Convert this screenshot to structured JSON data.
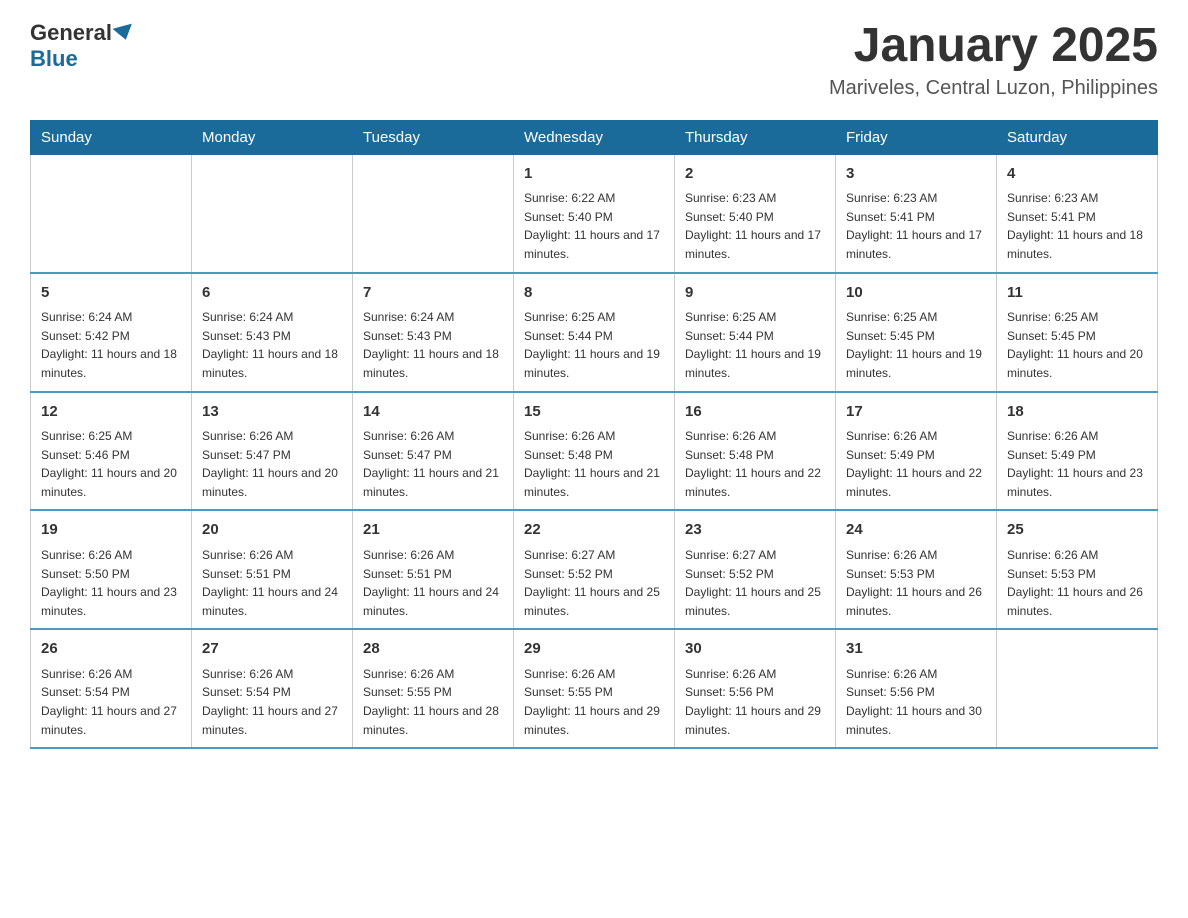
{
  "header": {
    "logo_general": "General",
    "logo_blue": "Blue",
    "month_title": "January 2025",
    "location": "Mariveles, Central Luzon, Philippines"
  },
  "days_of_week": [
    "Sunday",
    "Monday",
    "Tuesday",
    "Wednesday",
    "Thursday",
    "Friday",
    "Saturday"
  ],
  "weeks": [
    [
      {
        "day": "",
        "sunrise": "",
        "sunset": "",
        "daylight": ""
      },
      {
        "day": "",
        "sunrise": "",
        "sunset": "",
        "daylight": ""
      },
      {
        "day": "",
        "sunrise": "",
        "sunset": "",
        "daylight": ""
      },
      {
        "day": "1",
        "sunrise": "Sunrise: 6:22 AM",
        "sunset": "Sunset: 5:40 PM",
        "daylight": "Daylight: 11 hours and 17 minutes."
      },
      {
        "day": "2",
        "sunrise": "Sunrise: 6:23 AM",
        "sunset": "Sunset: 5:40 PM",
        "daylight": "Daylight: 11 hours and 17 minutes."
      },
      {
        "day": "3",
        "sunrise": "Sunrise: 6:23 AM",
        "sunset": "Sunset: 5:41 PM",
        "daylight": "Daylight: 11 hours and 17 minutes."
      },
      {
        "day": "4",
        "sunrise": "Sunrise: 6:23 AM",
        "sunset": "Sunset: 5:41 PM",
        "daylight": "Daylight: 11 hours and 18 minutes."
      }
    ],
    [
      {
        "day": "5",
        "sunrise": "Sunrise: 6:24 AM",
        "sunset": "Sunset: 5:42 PM",
        "daylight": "Daylight: 11 hours and 18 minutes."
      },
      {
        "day": "6",
        "sunrise": "Sunrise: 6:24 AM",
        "sunset": "Sunset: 5:43 PM",
        "daylight": "Daylight: 11 hours and 18 minutes."
      },
      {
        "day": "7",
        "sunrise": "Sunrise: 6:24 AM",
        "sunset": "Sunset: 5:43 PM",
        "daylight": "Daylight: 11 hours and 18 minutes."
      },
      {
        "day": "8",
        "sunrise": "Sunrise: 6:25 AM",
        "sunset": "Sunset: 5:44 PM",
        "daylight": "Daylight: 11 hours and 19 minutes."
      },
      {
        "day": "9",
        "sunrise": "Sunrise: 6:25 AM",
        "sunset": "Sunset: 5:44 PM",
        "daylight": "Daylight: 11 hours and 19 minutes."
      },
      {
        "day": "10",
        "sunrise": "Sunrise: 6:25 AM",
        "sunset": "Sunset: 5:45 PM",
        "daylight": "Daylight: 11 hours and 19 minutes."
      },
      {
        "day": "11",
        "sunrise": "Sunrise: 6:25 AM",
        "sunset": "Sunset: 5:45 PM",
        "daylight": "Daylight: 11 hours and 20 minutes."
      }
    ],
    [
      {
        "day": "12",
        "sunrise": "Sunrise: 6:25 AM",
        "sunset": "Sunset: 5:46 PM",
        "daylight": "Daylight: 11 hours and 20 minutes."
      },
      {
        "day": "13",
        "sunrise": "Sunrise: 6:26 AM",
        "sunset": "Sunset: 5:47 PM",
        "daylight": "Daylight: 11 hours and 20 minutes."
      },
      {
        "day": "14",
        "sunrise": "Sunrise: 6:26 AM",
        "sunset": "Sunset: 5:47 PM",
        "daylight": "Daylight: 11 hours and 21 minutes."
      },
      {
        "day": "15",
        "sunrise": "Sunrise: 6:26 AM",
        "sunset": "Sunset: 5:48 PM",
        "daylight": "Daylight: 11 hours and 21 minutes."
      },
      {
        "day": "16",
        "sunrise": "Sunrise: 6:26 AM",
        "sunset": "Sunset: 5:48 PM",
        "daylight": "Daylight: 11 hours and 22 minutes."
      },
      {
        "day": "17",
        "sunrise": "Sunrise: 6:26 AM",
        "sunset": "Sunset: 5:49 PM",
        "daylight": "Daylight: 11 hours and 22 minutes."
      },
      {
        "day": "18",
        "sunrise": "Sunrise: 6:26 AM",
        "sunset": "Sunset: 5:49 PM",
        "daylight": "Daylight: 11 hours and 23 minutes."
      }
    ],
    [
      {
        "day": "19",
        "sunrise": "Sunrise: 6:26 AM",
        "sunset": "Sunset: 5:50 PM",
        "daylight": "Daylight: 11 hours and 23 minutes."
      },
      {
        "day": "20",
        "sunrise": "Sunrise: 6:26 AM",
        "sunset": "Sunset: 5:51 PM",
        "daylight": "Daylight: 11 hours and 24 minutes."
      },
      {
        "day": "21",
        "sunrise": "Sunrise: 6:26 AM",
        "sunset": "Sunset: 5:51 PM",
        "daylight": "Daylight: 11 hours and 24 minutes."
      },
      {
        "day": "22",
        "sunrise": "Sunrise: 6:27 AM",
        "sunset": "Sunset: 5:52 PM",
        "daylight": "Daylight: 11 hours and 25 minutes."
      },
      {
        "day": "23",
        "sunrise": "Sunrise: 6:27 AM",
        "sunset": "Sunset: 5:52 PM",
        "daylight": "Daylight: 11 hours and 25 minutes."
      },
      {
        "day": "24",
        "sunrise": "Sunrise: 6:26 AM",
        "sunset": "Sunset: 5:53 PM",
        "daylight": "Daylight: 11 hours and 26 minutes."
      },
      {
        "day": "25",
        "sunrise": "Sunrise: 6:26 AM",
        "sunset": "Sunset: 5:53 PM",
        "daylight": "Daylight: 11 hours and 26 minutes."
      }
    ],
    [
      {
        "day": "26",
        "sunrise": "Sunrise: 6:26 AM",
        "sunset": "Sunset: 5:54 PM",
        "daylight": "Daylight: 11 hours and 27 minutes."
      },
      {
        "day": "27",
        "sunrise": "Sunrise: 6:26 AM",
        "sunset": "Sunset: 5:54 PM",
        "daylight": "Daylight: 11 hours and 27 minutes."
      },
      {
        "day": "28",
        "sunrise": "Sunrise: 6:26 AM",
        "sunset": "Sunset: 5:55 PM",
        "daylight": "Daylight: 11 hours and 28 minutes."
      },
      {
        "day": "29",
        "sunrise": "Sunrise: 6:26 AM",
        "sunset": "Sunset: 5:55 PM",
        "daylight": "Daylight: 11 hours and 29 minutes."
      },
      {
        "day": "30",
        "sunrise": "Sunrise: 6:26 AM",
        "sunset": "Sunset: 5:56 PM",
        "daylight": "Daylight: 11 hours and 29 minutes."
      },
      {
        "day": "31",
        "sunrise": "Sunrise: 6:26 AM",
        "sunset": "Sunset: 5:56 PM",
        "daylight": "Daylight: 11 hours and 30 minutes."
      },
      {
        "day": "",
        "sunrise": "",
        "sunset": "",
        "daylight": ""
      }
    ]
  ]
}
